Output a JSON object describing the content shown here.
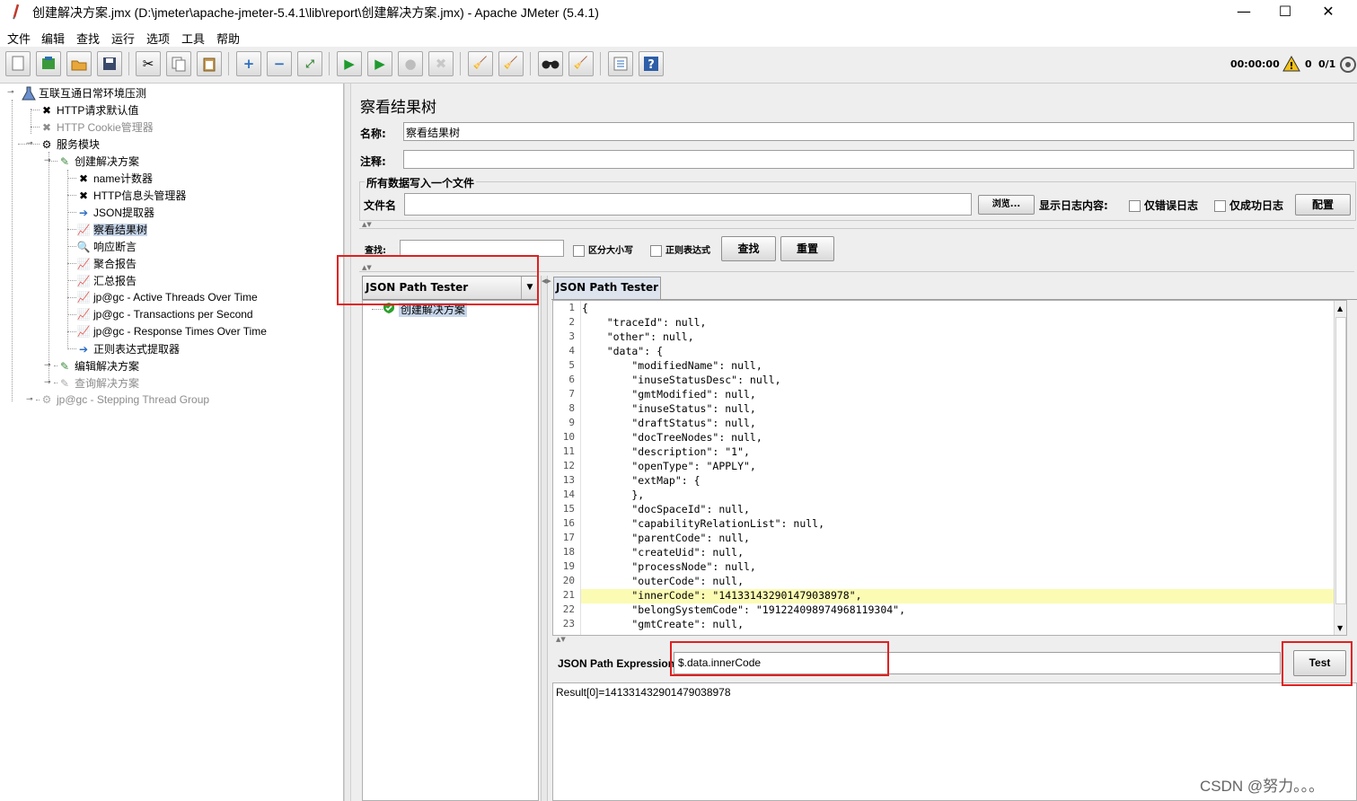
{
  "window": {
    "title": "创建解决方案.jmx (D:\\jmeter\\apache-jmeter-5.4.1\\lib\\report\\创建解决方案.jmx) - Apache JMeter (5.4.1)",
    "minimize": "—",
    "maximize": "☐",
    "close": "✕"
  },
  "menu": [
    "文件",
    "编辑",
    "查找",
    "运行",
    "选项",
    "工具",
    "帮助"
  ],
  "status": {
    "time": "00:00:00",
    "warnings": "0",
    "threads": "0/1"
  },
  "tree": {
    "root": "互联互通日常环境压测",
    "http_defaults": "HTTP请求默认值",
    "cookie_manager": "HTTP Cookie管理器",
    "service_module": "服务模块",
    "create_solution": "创建解决方案",
    "name_counter": "name计数器",
    "header_manager": "HTTP信息头管理器",
    "json_extractor": "JSON提取器",
    "view_results_tree": "察看结果树",
    "response_assertion": "响应断言",
    "aggregate_report": "聚合报告",
    "summary_report": "汇总报告",
    "active_threads": "jp@gc - Active Threads Over Time",
    "tps": "jp@gc - Transactions per Second",
    "response_times": "jp@gc - Response Times Over Time",
    "regex_extractor": "正则表达式提取器",
    "edit_solution": "编辑解决方案",
    "query_solution": "查询解决方案",
    "stepping_group": "jp@gc - Stepping Thread Group"
  },
  "panel": {
    "title": "察看结果树",
    "name_label": "名称:",
    "name_value": "察看结果树",
    "comment_label": "注释:",
    "comment_value": "",
    "file_section": "所有数据写入一个文件",
    "filename_label": "文件名",
    "filename_value": "",
    "browse": "浏览...",
    "log_display": "显示日志内容:",
    "errors_only": "仅错误日志",
    "success_only": "仅成功日志",
    "configure": "配置"
  },
  "search": {
    "label": "查找:",
    "value": "",
    "case_sensitive": "区分大小写",
    "regex": "正则表达式",
    "find": "查找",
    "reset": "重置"
  },
  "renderer": {
    "selected": "JSON Path Tester"
  },
  "results": {
    "sample": "创建解决方案"
  },
  "tab": "JSON Path Tester",
  "json_lines": [
    "{",
    "    \"traceId\": null,",
    "    \"other\": null,",
    "    \"data\": {",
    "        \"modifiedName\": null,",
    "        \"inuseStatusDesc\": null,",
    "        \"gmtModified\": null,",
    "        \"inuseStatus\": null,",
    "        \"draftStatus\": null,",
    "        \"docTreeNodes\": null,",
    "        \"description\": \"1\",",
    "        \"openType\": \"APPLY\",",
    "        \"extMap\": {",
    "        },",
    "        \"docSpaceId\": null,",
    "        \"capabilityRelationList\": null,",
    "        \"parentCode\": null,",
    "        \"createUid\": null,",
    "        \"processNode\": null,",
    "        \"outerCode\": null,",
    "        \"innerCode\": \"141331432901479038978\",",
    "        \"belongSystemCode\": \"191224098974968119304\",",
    "        \"gmtCreate\": null,"
  ],
  "highlight_line": 21,
  "expression": {
    "label": "JSON Path Expression",
    "value": "$.data.innerCode",
    "test": "Test"
  },
  "result_text": "Result[0]=141331432901479038978",
  "watermark": "CSDN @努力。。。",
  "colors": {
    "highlight": "#fbfbb4",
    "annotation": "#e02020",
    "selection": "#c7d6ea"
  }
}
